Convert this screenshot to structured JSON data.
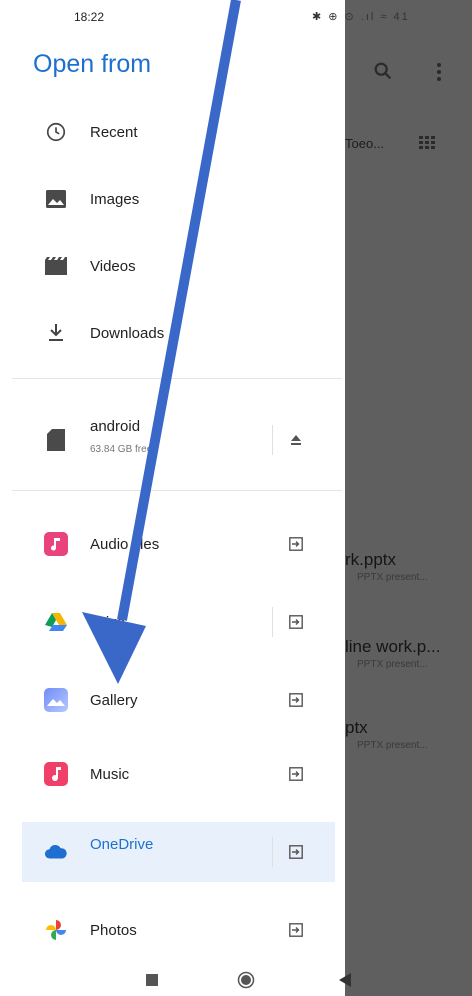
{
  "status_bar": {
    "time": "18:22",
    "icons": "✱ ⊕ ⊙ .ıl ≈ 41"
  },
  "drawer": {
    "title": "Open from",
    "items": [
      {
        "label": "Recent",
        "icon": "clock-icon"
      },
      {
        "label": "Images",
        "icon": "image-icon"
      },
      {
        "label": "Videos",
        "icon": "video-icon"
      },
      {
        "label": "Downloads",
        "icon": "download-icon"
      }
    ],
    "storage": {
      "label": "android",
      "sublabel": "63.84 GB free",
      "icon": "sd-card-icon",
      "action_icon": "eject-icon"
    },
    "apps": [
      {
        "label": "Audio files",
        "icon": "audio-files-icon",
        "color": "#e8437c"
      },
      {
        "label": "Drive",
        "icon": "drive-icon"
      },
      {
        "label": "Gallery",
        "icon": "gallery-icon"
      },
      {
        "label": "Music",
        "icon": "music-icon",
        "color": "#f0406a"
      },
      {
        "label": "OneDrive",
        "icon": "onedrive-icon",
        "color": "#1f6fd1",
        "selected": true
      },
      {
        "label": "Photos",
        "icon": "photos-icon"
      }
    ]
  },
  "background": {
    "sort_label": "Toeo...",
    "files": [
      {
        "name": "rk.pptx",
        "sub": "PPTX present..."
      },
      {
        "name": "line work.p...",
        "sub": "PPTX present..."
      },
      {
        "name": "ptx",
        "sub": "PPTX present..."
      }
    ]
  },
  "colors": {
    "accent": "#1f6fd1",
    "arrow": "#3a68c8",
    "scrim": "#5f5f5f"
  }
}
